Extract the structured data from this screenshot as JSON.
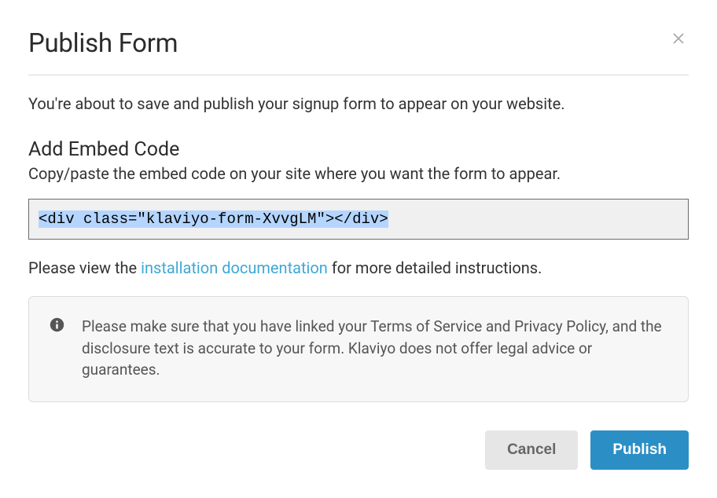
{
  "modal": {
    "title": "Publish Form",
    "intro": "You're about to save and publish your signup form to appear on your website.",
    "embed": {
      "heading": "Add Embed Code",
      "sub": "Copy/paste the embed code on your site where you want the form to appear.",
      "code": "<div class=\"klaviyo-form-XvvgLM\"></div>"
    },
    "docs": {
      "prefix": "Please view the ",
      "link_text": "installation documentation",
      "suffix": " for more detailed instructions."
    },
    "notice": "Please make sure that you have linked your Terms of Service and Privacy Policy, and the disclosure text is accurate to your form. Klaviyo does not offer legal advice or guarantees."
  },
  "buttons": {
    "cancel": "Cancel",
    "publish": "Publish"
  }
}
